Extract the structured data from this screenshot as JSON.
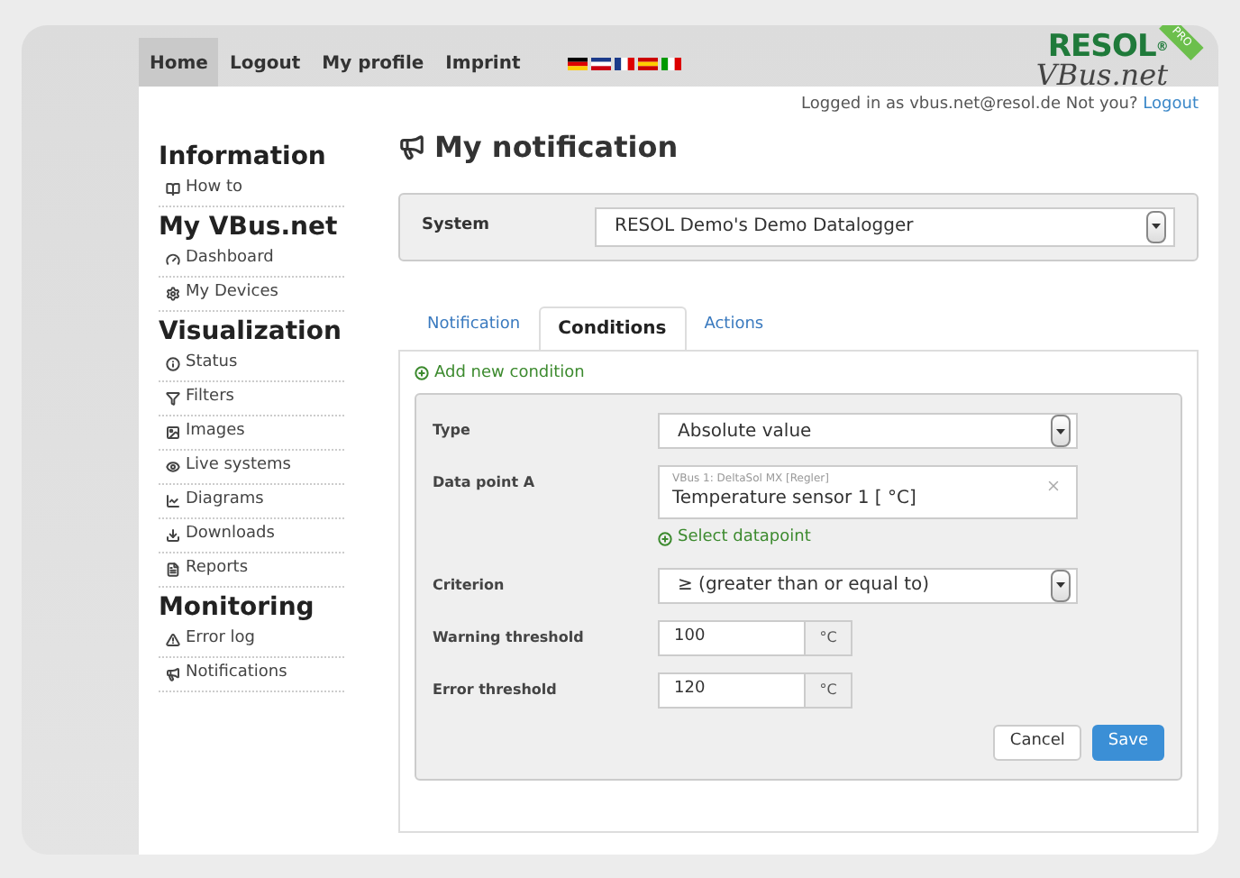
{
  "nav": [
    {
      "label": "Home",
      "selected": true
    },
    {
      "label": "Logout",
      "selected": false
    },
    {
      "label": "My profile",
      "selected": false
    },
    {
      "label": "Imprint",
      "selected": false
    }
  ],
  "logo": {
    "brand": "RESOL",
    "mark": "®",
    "badge": "PRO",
    "product": "VBus.net"
  },
  "login": {
    "text": "Logged in as vbus.net@resol.de Not you?",
    "link": "Logout"
  },
  "sidebar": [
    {
      "heading": "Information",
      "items": [
        "How to"
      ]
    },
    {
      "heading": "My VBus.net",
      "items": [
        "Dashboard",
        "My Devices"
      ]
    },
    {
      "heading": "Visualization",
      "items": [
        "Status",
        "Filters",
        "Images",
        "Live systems",
        "Diagrams",
        "Downloads",
        "Reports"
      ]
    },
    {
      "heading": "Monitoring",
      "items": [
        "Error log",
        "Notifications"
      ]
    }
  ],
  "page_title": "My notification",
  "system": {
    "label": "System",
    "value": "RESOL Demo's Demo Datalogger"
  },
  "tabs": [
    {
      "label": "Notification",
      "selected": false
    },
    {
      "label": "Conditions",
      "selected": true
    },
    {
      "label": "Actions",
      "selected": false
    }
  ],
  "add_condition": "Add new condition",
  "form": [
    {
      "kind": "select",
      "label": "Type",
      "value": "Absolute value"
    },
    {
      "kind": "datapoint",
      "label": "Data point A",
      "source": "VBus 1: DeltaSol MX [Regler]",
      "value": "Temperature sensor 1 [ °C]",
      "link": "Select datapoint"
    },
    {
      "kind": "select",
      "label": "Criterion",
      "value": "≥ (greater than or equal to)"
    },
    {
      "kind": "unit",
      "label": "Warning threshold",
      "value": "100",
      "unit": "°C"
    },
    {
      "kind": "unit",
      "label": "Error threshold",
      "value": "120",
      "unit": "°C"
    }
  ],
  "buttons": {
    "cancel": "Cancel",
    "save": "Save"
  }
}
